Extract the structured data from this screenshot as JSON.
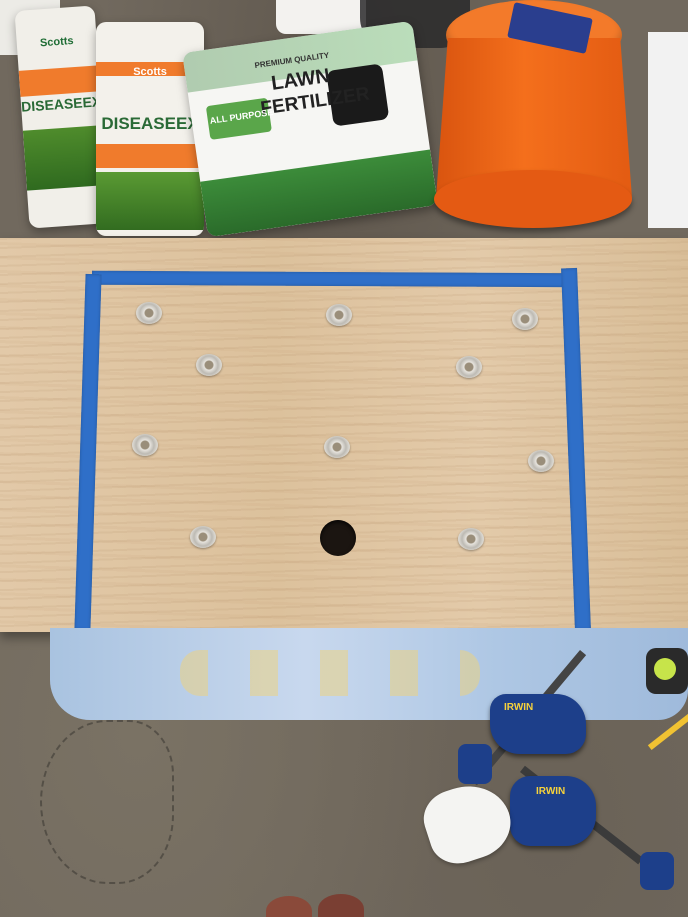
{
  "scene": {
    "fertilizer_bag": {
      "line1": "PREMIUM QUALITY",
      "line2": "LAWN",
      "line3": "FERTILIZER",
      "line4": "ALL PURPOSE"
    },
    "scotts_bag_left": {
      "brand": "Scotts",
      "product": "DISEASEEX"
    },
    "scotts_bag_right": {
      "brand": "Scotts",
      "product": "DISEASEEX"
    },
    "tape_label": "IRWIN",
    "colors": {
      "plywood": "#dcc19c",
      "painters_tape": "#2f6fc8",
      "bucket": "#f06a1c",
      "clamp": "#1d3f8a",
      "floor": "#71695e"
    }
  }
}
